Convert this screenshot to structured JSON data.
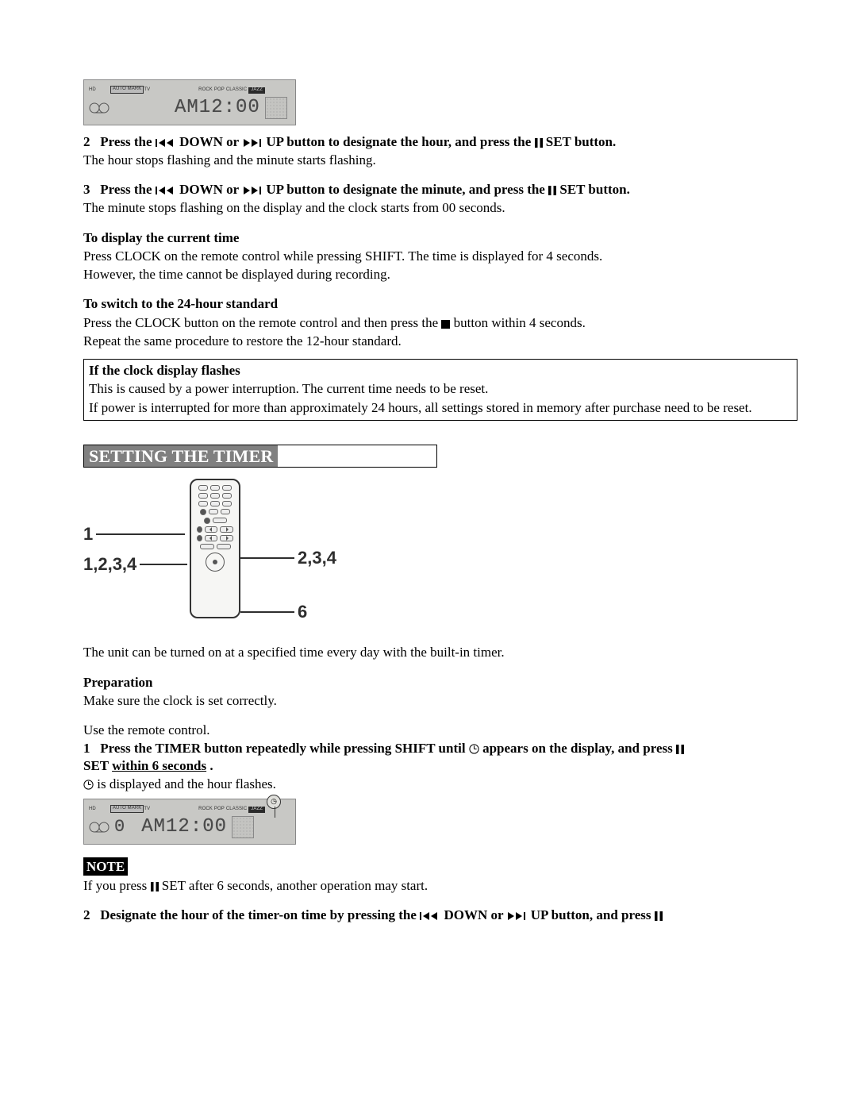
{
  "step2": {
    "num": "2",
    "lead": "Press the ",
    "mid1": " DOWN or ",
    "mid2": " UP button to designate the hour, and press the ",
    "tail": " SET button.",
    "body": "The hour stops flashing and the minute starts flashing."
  },
  "step3": {
    "num": "3",
    "lead": "Press the ",
    "mid1": " DOWN or ",
    "mid2": " UP button to designate the minute, and press the ",
    "tail": " SET button.",
    "body": "The minute stops flashing on the display and the clock starts from 00 seconds."
  },
  "displayTime": {
    "heading": "To display the current time",
    "line1": "Press CLOCK on the remote control while pressing SHIFT.  The time is displayed for 4 seconds.",
    "line2": "However, the time cannot be displayed during recording."
  },
  "switch24": {
    "heading": "To switch to the 24-hour standard",
    "line1_a": "Press the CLOCK button on the remote control and then press the ",
    "line1_b": " button within 4 seconds.",
    "line2": "Repeat the same procedure to restore the 12-hour standard."
  },
  "flashNote": {
    "heading": "If the clock display flashes",
    "line1": "This is caused by a power interruption.  The current time needs to be reset.",
    "line2": "If power is interrupted for more than approximately 24 hours, all settings stored in memory after purchase need to be reset."
  },
  "settingTimer": {
    "title": "SETTING THE TIMER",
    "intro": "The unit can be turned on at a specified time every day with the built-in timer.",
    "prepHeading": "Preparation",
    "prepBody": "Make sure the clock is set correctly.",
    "useRemote": "Use the remote control.",
    "step1": {
      "num": "1",
      "a": "Press the TIMER button repeatedly while pressing SHIFT until ",
      "b": " appears on the display, and press ",
      "c": "SET ",
      "d": "within 6 seconds",
      "e": ".",
      "body_a": "",
      "body_b": " is displayed and the hour flashes."
    },
    "noteBadge": "NOTE",
    "noteBody_a": "If you press ",
    "noteBody_b": " SET after 6 seconds, another operation may start.",
    "step2": {
      "num": "2",
      "a": "Designate the hour of the timer-on time by pressing the ",
      "b": " DOWN or ",
      "c": " UP button, and press "
    }
  },
  "remoteCallouts": {
    "left1": "1",
    "left2": "1,2,3,4",
    "right1": "2,3,4",
    "right2": "6"
  },
  "lcd": {
    "ampmTime": "AM12:00",
    "tunerPreset": "0",
    "labels": {
      "hd": "HD",
      "automark": "AUTO MARK",
      "tv": "TV",
      "rock": "ROCK",
      "pop": "POP",
      "classic": "CLASSIC",
      "jazz": "JAZZ"
    }
  }
}
